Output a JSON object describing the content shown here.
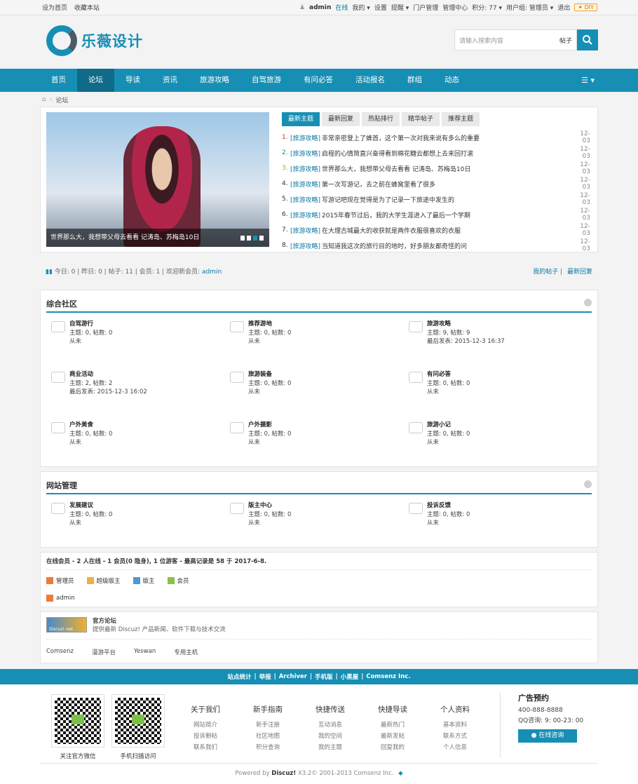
{
  "topbar": {
    "set_home": "设为首页",
    "bookmark": "收藏本站",
    "username": "admin",
    "online": "在线",
    "my": "我的",
    "settings": "设置",
    "remind": "提醒",
    "portal": "门户管理",
    "admin_center": "管理中心",
    "points": "积分: 77",
    "usergroup": "用户组: 管理员",
    "logout": "退出",
    "diy": "DIY"
  },
  "header": {
    "logo_text": "乐薇设计",
    "search_placeholder": "请输入搜索内容",
    "search_type": "帖子"
  },
  "nav": {
    "items": [
      "首页",
      "论坛",
      "导读",
      "资讯",
      "旅游攻略",
      "自驾旅游",
      "有问必答",
      "活动报名",
      "群组",
      "动态"
    ],
    "active": "论坛"
  },
  "breadcrumb": {
    "current": "论坛"
  },
  "slider": {
    "caption": "世界那么大，我想带父母去看看 记涛岛、苏梅岛10日"
  },
  "thread_tabs": [
    "最新主题",
    "最新回复",
    "热贴排行",
    "精华帖子",
    "推荐主题"
  ],
  "threads": [
    {
      "num": "1.",
      "cat": "[旅游攻略]",
      "title": "非常亲密登上了蜂首，这个第一次对我来说有多么的重要",
      "date": "12-03",
      "color": "#c0392b"
    },
    {
      "num": "2.",
      "cat": "[旅游攻略]",
      "title": "启程的心情简直兴奋得看到棉花糖云都想上去来回打滚",
      "date": "12-03",
      "color": "#2e8b57"
    },
    {
      "num": "3.",
      "cat": "[旅游攻略]",
      "title": "世界那么大，我想带父母去看看 记涛岛、苏梅岛10日",
      "date": "12-03",
      "color": "#c8a000"
    },
    {
      "num": "4.",
      "cat": "[旅游攻略]",
      "title": "第一次写游记，去之前在蜂窝里看了很多",
      "date": "12-03",
      "color": "#333"
    },
    {
      "num": "5.",
      "cat": "[旅游攻略]",
      "title": "写游记吧现在觉得是为了记录一下旅途中发生的",
      "date": "12-03",
      "color": "#333"
    },
    {
      "num": "6.",
      "cat": "[旅游攻略]",
      "title": "2015年春节过后，我的大学生涯进入了最后一个学期",
      "date": "12-03",
      "color": "#333"
    },
    {
      "num": "7.",
      "cat": "[旅游攻略]",
      "title": "在大理古城最大的收获就是两件衣服很喜欢的衣服",
      "date": "12-03",
      "color": "#333"
    },
    {
      "num": "8.",
      "cat": "[旅游攻略]",
      "title": "当知道我这次的旅行目的地时，好多朋友都奇怪的问",
      "date": "12-03",
      "color": "#333"
    }
  ],
  "stats": {
    "today": "今日: 0",
    "yesterday": "昨日: 0",
    "posts": "帖子: 11",
    "members": "会员: 1",
    "welcome": "欢迎新会员:",
    "newest": "admin",
    "my_posts": "我的帖子",
    "latest_reply": "最新回复"
  },
  "section1": {
    "title": "综合社区",
    "forums": [
      {
        "name": "自驾游行",
        "counts": "主题: 0, 帖数: 0",
        "last": "从未"
      },
      {
        "name": "推荐游地",
        "counts": "主题: 0, 帖数: 0",
        "last": "从未"
      },
      {
        "name": "旅游攻略",
        "counts": "主题: 9, 帖数: 9",
        "last": "最后发表: 2015-12-3 16:37"
      },
      {
        "name": "商业活动",
        "counts": "主题: 2, 帖数: 2",
        "last": "最后发表: 2015-12-3 16:02"
      },
      {
        "name": "旅游装备",
        "counts": "主题: 0, 帖数: 0",
        "last": "从未"
      },
      {
        "name": "有问必答",
        "counts": "主题: 0, 帖数: 0",
        "last": "从未"
      },
      {
        "name": "户外美食",
        "counts": "主题: 0, 帖数: 0",
        "last": "从未"
      },
      {
        "name": "户外摄影",
        "counts": "主题: 0, 帖数: 0",
        "last": "从未"
      },
      {
        "name": "旅游小记",
        "counts": "主题: 0, 帖数: 0",
        "last": "从未"
      }
    ]
  },
  "section2": {
    "title": "网站管理",
    "forums": [
      {
        "name": "发展建议",
        "counts": "主题: 0, 帖数: 0",
        "last": "从未"
      },
      {
        "name": "版主中心",
        "counts": "主题: 0, 帖数: 0",
        "last": "从未"
      },
      {
        "name": "投诉反馈",
        "counts": "主题: 0, 帖数: 0",
        "last": "从未"
      }
    ]
  },
  "online": {
    "summary": "在线会员 - 2 人在线 - 1 会员(0 隐身), 1 位游客 - 最高记录是 58 于 2017-6-8.",
    "legend": [
      "管理员",
      "超级版主",
      "版主",
      "会员"
    ],
    "user": "admin"
  },
  "official": {
    "logo": "Discuz! net",
    "title": "官方论坛",
    "desc": "提供最新 Discuz! 产品新闻、软件下载与技术交流",
    "partners": [
      "Comsenz",
      "漫游平台",
      "Yeswan",
      "专用主机"
    ]
  },
  "footbar": {
    "links": [
      "站点统计",
      "举报",
      "Archiver",
      "手机版",
      "小黑屋",
      "Comsenz Inc."
    ]
  },
  "footer": {
    "qr1": "关注官方微信",
    "qr2": "手机扫描访问",
    "cols": [
      {
        "title": "关于我们",
        "items": [
          "网站简介",
          "投诉删帖",
          "联系我们"
        ]
      },
      {
        "title": "新手指南",
        "items": [
          "新手注册",
          "社区地图",
          "积分查询"
        ]
      },
      {
        "title": "快捷传送",
        "items": [
          "互动消息",
          "我的空间",
          "我的主题"
        ]
      },
      {
        "title": "快捷导读",
        "items": [
          "最新热门",
          "最新发帖",
          "回复我的"
        ]
      },
      {
        "title": "个人资料",
        "items": [
          "基本资料",
          "联系方式",
          "个人信息"
        ]
      }
    ],
    "ad_title": "广告预约",
    "phone": "400-888-8888",
    "qq": "QQ咨询: 9: 00-23: 00",
    "chat": "在线咨询",
    "powered_prefix": "Powered by",
    "powered_brand": "Discuz!",
    "powered_suffix": "X3.2© 2001-2013 Comsenz Inc."
  },
  "colors": {
    "accent": "#178fb4",
    "dark": "#0f6b88"
  }
}
